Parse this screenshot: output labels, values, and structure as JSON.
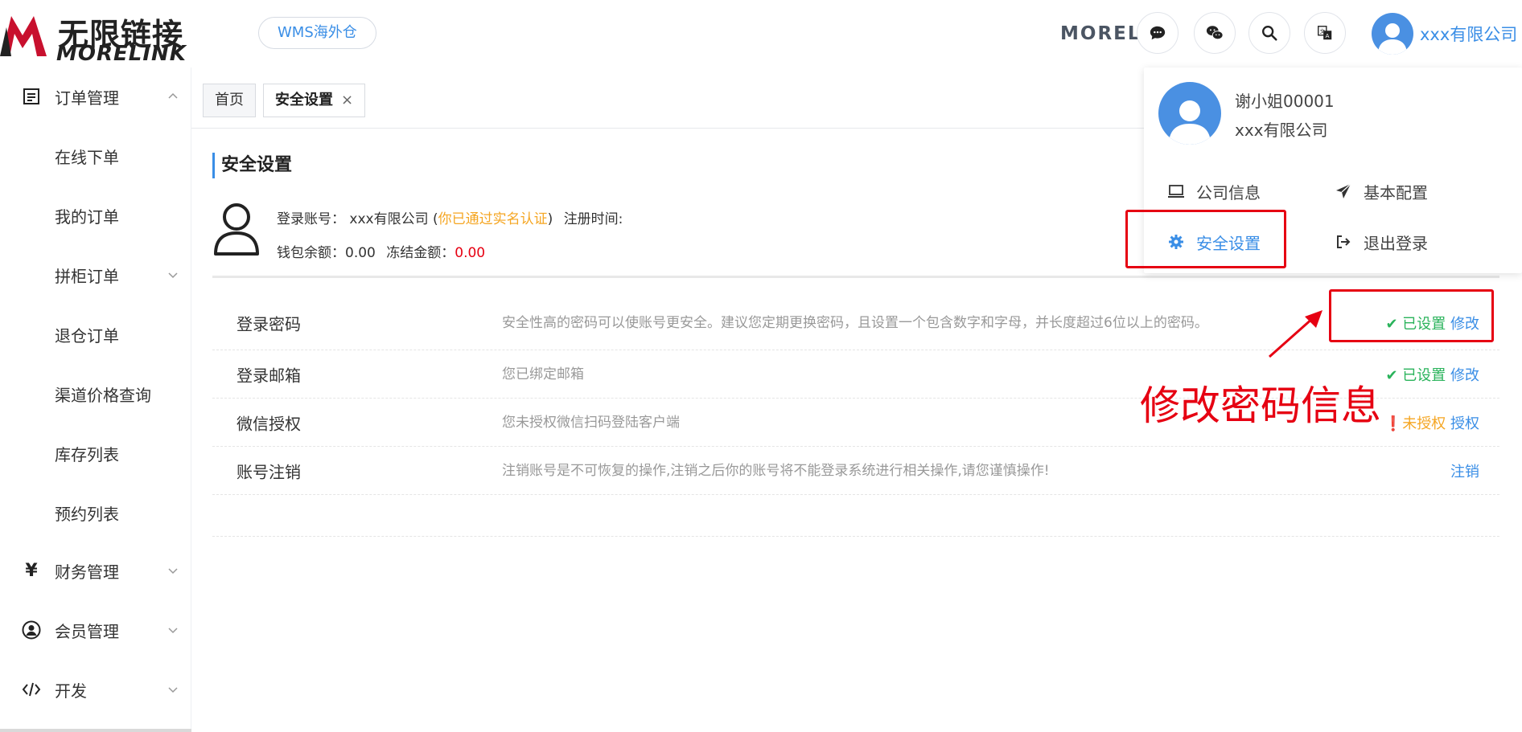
{
  "header": {
    "logo_cn": "无限链接",
    "logo_en": "MORELINK",
    "wms_tag": "WMS海外仓",
    "brand_text": "MORELI",
    "icons": [
      "chat-icon",
      "wechat-icon",
      "search-icon",
      "translate-icon"
    ],
    "user_name": "xxx有限公司"
  },
  "sidebar": {
    "items": [
      {
        "label": "订单管理",
        "icon": "order-icon",
        "chevron": "up"
      },
      {
        "label": "在线下单"
      },
      {
        "label": "我的订单"
      },
      {
        "label": "拼柜订单",
        "chevron": "down"
      },
      {
        "label": "退仓订单"
      },
      {
        "label": "渠道价格查询"
      },
      {
        "label": "库存列表"
      },
      {
        "label": "预约列表"
      },
      {
        "label": "财务管理",
        "icon": "yen-icon",
        "chevron": "down"
      },
      {
        "label": "会员管理",
        "icon": "member-icon",
        "chevron": "down"
      },
      {
        "label": "开发",
        "icon": "code-icon",
        "chevron": "down"
      }
    ]
  },
  "tabs": [
    {
      "label": "首页"
    },
    {
      "label": "安全设置",
      "close": "×"
    }
  ],
  "content": {
    "title": "安全设置",
    "account": {
      "login_label": "登录账号：",
      "login_value": "xxx有限公司",
      "paren_open": " (",
      "verified": "你已通过实名认证",
      "paren_close": ")",
      "reg_label": "注册时间:",
      "wallet_label": "钱包余额：",
      "wallet_value": "0.00",
      "frozen_label": "冻结金额：",
      "frozen_value": "0.00"
    },
    "rows": [
      {
        "name": "登录密码",
        "desc": "安全性高的密码可以使账号更安全。建议您定期更换密码，且设置一个包含数字和字母，并长度超过6位以上的密码。",
        "status": "已设置",
        "action": "修改"
      },
      {
        "name": "登录邮箱",
        "desc": "您已绑定邮箱",
        "status": "已设置",
        "action": "修改"
      },
      {
        "name": "微信授权",
        "desc": "您未授权微信扫码登陆客户端",
        "status": "未授权",
        "action": "授权"
      },
      {
        "name": "账号注销",
        "desc": "注销账号是不可恢复的操作,注销之后你的账号将不能登录系统进行相关操作,请您谨慎操作!",
        "status": "",
        "action": "注销"
      }
    ]
  },
  "dropdown": {
    "name": "谢小姐00001",
    "company": "xxx有限公司",
    "items": [
      {
        "label": "公司信息",
        "icon": "laptop-icon"
      },
      {
        "label": "基本配置",
        "icon": "send-icon"
      },
      {
        "label": "安全设置",
        "icon": "gear-icon",
        "active": true
      },
      {
        "label": "退出登录",
        "icon": "logout-icon"
      }
    ]
  },
  "annotation": {
    "text": "修改密码信息",
    "color": "#e60012"
  },
  "colors": {
    "accent": "#3a8ee6",
    "success": "#2ab35b",
    "warning": "#f5a623",
    "danger": "#e60012"
  }
}
